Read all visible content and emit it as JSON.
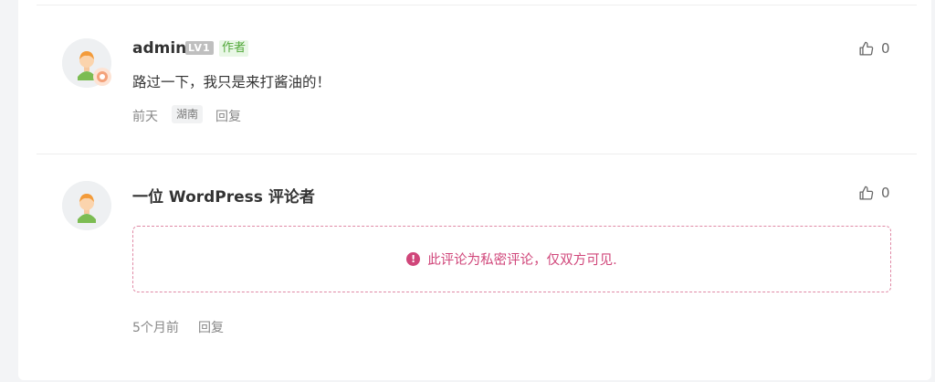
{
  "comments": [
    {
      "author": "admin",
      "level": "LV1",
      "tag": "作者",
      "text": "路过一下，我只是来打酱油的！",
      "time": "前天",
      "region": "湖南",
      "reply_label": "回复",
      "likes": "0"
    },
    {
      "author": "一位 WordPress 评论者",
      "private_notice": "此评论为私密评论，仅双方可见.",
      "time": "5个月前",
      "reply_label": "回复",
      "likes": "0"
    }
  ],
  "icons": {
    "like": "thumbs-up-icon",
    "warning": "exclamation-circle-icon",
    "avatar": "user-avatar-icon"
  },
  "colors": {
    "author_tag_bg": "#e9f7e6",
    "author_tag_text": "#52a83a",
    "private_border": "#e08aa6",
    "private_text": "#d0467a"
  }
}
